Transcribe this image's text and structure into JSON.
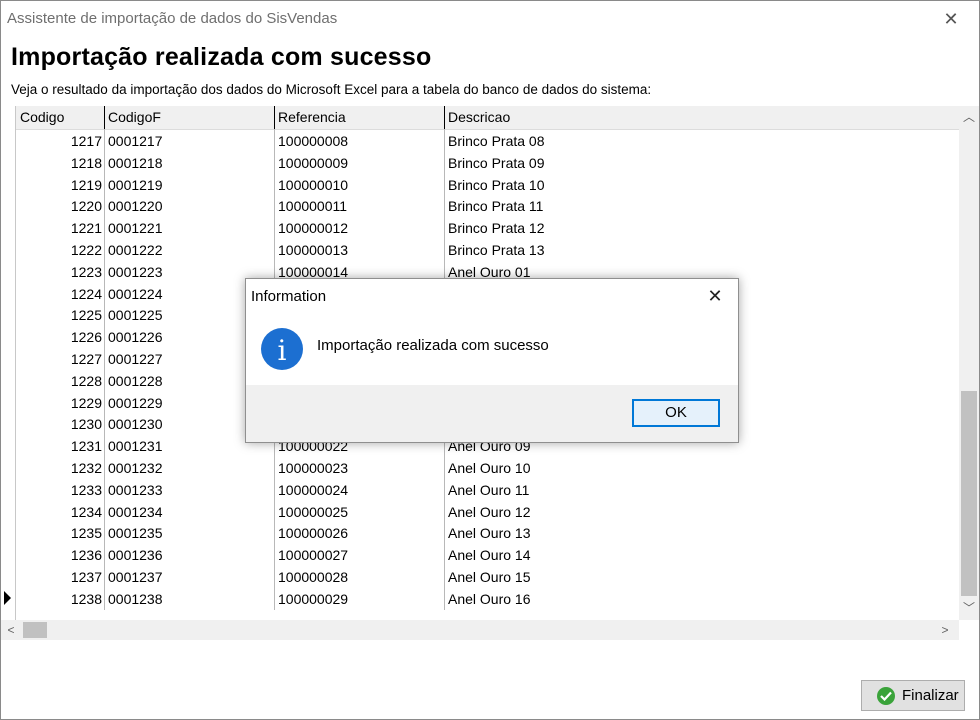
{
  "window": {
    "title": "Assistente de importação de dados do SisVendas",
    "close_glyph": "✕"
  },
  "heading": "Importação realizada com sucesso",
  "subheading": "Veja o resultado da importação dos dados do Microsoft Excel para a tabela do banco de dados do sistema:",
  "grid": {
    "columns": [
      "Codigo",
      "CodigoF",
      "Referencia",
      "Descricao"
    ],
    "rows": [
      [
        "1217",
        "0001217",
        "100000008",
        "Brinco Prata 08"
      ],
      [
        "1218",
        "0001218",
        "100000009",
        "Brinco Prata 09"
      ],
      [
        "1219",
        "0001219",
        "100000010",
        "Brinco Prata 10"
      ],
      [
        "1220",
        "0001220",
        "100000011",
        "Brinco Prata 11"
      ],
      [
        "1221",
        "0001221",
        "100000012",
        "Brinco Prata 12"
      ],
      [
        "1222",
        "0001222",
        "100000013",
        "Brinco Prata 13"
      ],
      [
        "1223",
        "0001223",
        "100000014",
        "Anel Ouro 01"
      ],
      [
        "1224",
        "0001224",
        "",
        ""
      ],
      [
        "1225",
        "0001225",
        "",
        ""
      ],
      [
        "1226",
        "0001226",
        "",
        ""
      ],
      [
        "1227",
        "0001227",
        "",
        ""
      ],
      [
        "1228",
        "0001228",
        "",
        ""
      ],
      [
        "1229",
        "0001229",
        "",
        ""
      ],
      [
        "1230",
        "0001230",
        "",
        ""
      ],
      [
        "1231",
        "0001231",
        "100000022",
        "Anel Ouro 09"
      ],
      [
        "1232",
        "0001232",
        "100000023",
        "Anel Ouro 10"
      ],
      [
        "1233",
        "0001233",
        "100000024",
        "Anel Ouro 11"
      ],
      [
        "1234",
        "0001234",
        "100000025",
        "Anel Ouro 12"
      ],
      [
        "1235",
        "0001235",
        "100000026",
        "Anel Ouro 13"
      ],
      [
        "1236",
        "0001236",
        "100000027",
        "Anel Ouro 14"
      ],
      [
        "1237",
        "0001237",
        "100000028",
        "Anel Ouro 15"
      ],
      [
        "1238",
        "0001238",
        "100000029",
        "Anel Ouro 16"
      ]
    ],
    "scroll_up_glyph": "︿",
    "scroll_down_glyph": "﹀",
    "scroll_left_glyph": "<",
    "scroll_right_glyph": ">"
  },
  "finish_button": {
    "label": "Finalizar",
    "icon": "check-circle-icon",
    "icon_color": "#3aa33a"
  },
  "dialog": {
    "title": "Information",
    "close_glyph": "✕",
    "message": "Importação realizada com sucesso",
    "icon": "info-icon",
    "icon_glyph": "i",
    "icon_color": "#1c6fd1",
    "ok_label": "OK"
  }
}
